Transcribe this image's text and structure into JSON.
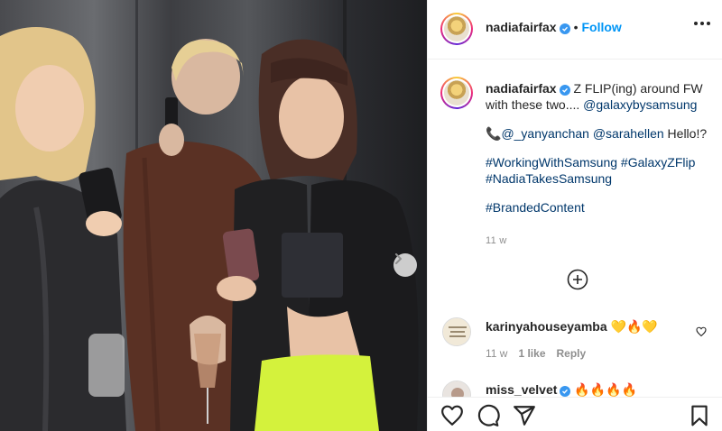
{
  "post": {
    "next_icon": "chevron-right-icon"
  },
  "header": {
    "username": "nadiafairfax",
    "separator": "•",
    "follow_label": "Follow",
    "more_icon": "ellipsis-icon"
  },
  "caption": {
    "username": "nadiafairfax",
    "text_1": " Z FLIP(ing) around FW with these two....",
    "mention_1": "@galaxybysamsung",
    "phone_emoji": "📞",
    "mention_2": "@_yanyanchan",
    "mention_3": "@sarahellen",
    "text_2": " Hello!?",
    "hashtag_1": "#WorkingWithSamsung",
    "hashtag_2": "#GalaxyZFlip",
    "hashtag_3": "#NadiaTakesSamsung",
    "hashtag_4": "#BrandedContent",
    "time": "11 w"
  },
  "comments": [
    {
      "username": "karinyahouseyamba",
      "text": " 💛🔥💛",
      "time": "11 w",
      "likes": "1 like",
      "reply_label": "Reply"
    },
    {
      "username": "miss_velvet",
      "text": " 🔥🔥🔥🔥"
    }
  ],
  "actions": {
    "like_icon": "heart-icon",
    "comment_icon": "comment-icon",
    "share_icon": "share-icon",
    "save_icon": "bookmark-icon"
  },
  "colors": {
    "link": "#00376b",
    "follow": "#0095f6",
    "verified": "#3897f0",
    "muted": "#8e8e8e"
  }
}
